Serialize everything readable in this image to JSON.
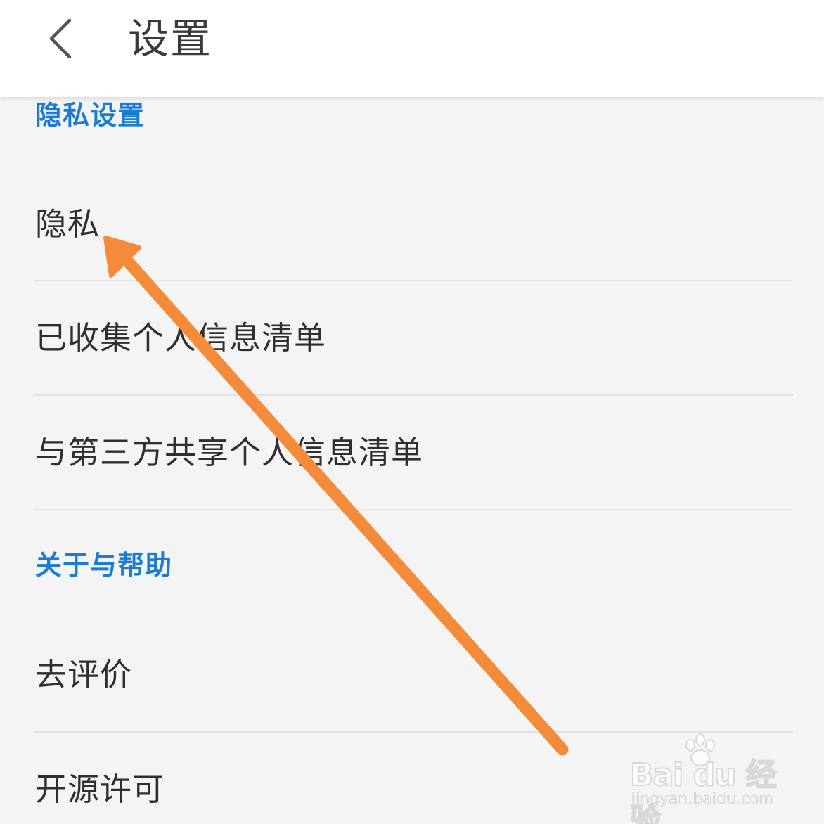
{
  "header": {
    "back_icon": "chevron-left-icon",
    "title": "设置"
  },
  "sections": [
    {
      "title": "隐私设置",
      "items": [
        {
          "label": "隐私"
        },
        {
          "label": "已收集个人信息清单"
        },
        {
          "label": "与第三方共享个人信息清单"
        }
      ]
    },
    {
      "title": "关于与帮助",
      "items": [
        {
          "label": "去评价"
        },
        {
          "label": "开源许可"
        }
      ]
    }
  ],
  "annotation": {
    "type": "arrow",
    "color": "#f38b3a"
  },
  "watermark": {
    "logo_text": "Bai du 经验",
    "url": "jingyan.baidu.com"
  },
  "colors": {
    "accent": "#1b7bd6",
    "background": "#f4f4f4",
    "header_bg": "#ffffff",
    "text": "#2f2f2f"
  }
}
